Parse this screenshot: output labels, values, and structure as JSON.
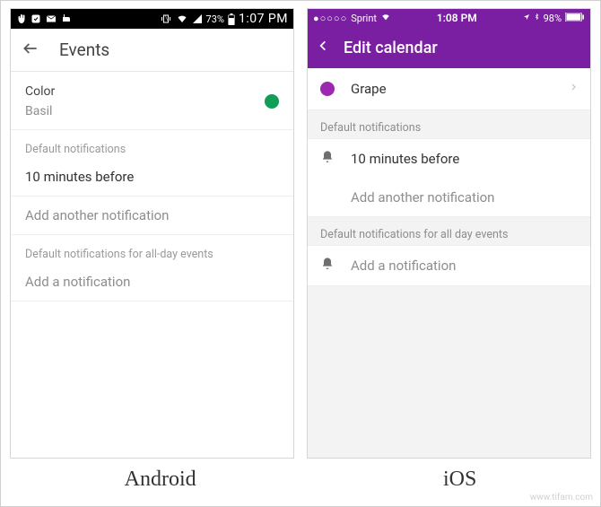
{
  "android": {
    "status": {
      "battery": "73%",
      "time": "1:07 PM"
    },
    "appbar": {
      "title": "Events"
    },
    "color": {
      "label": "Color",
      "name": "Basil",
      "swatch": "#0f9d58"
    },
    "defaults_title": "Default notifications",
    "notif1": "10 minutes before",
    "add_another": "Add another notification",
    "allday_title": "Default notifications for all-day events",
    "add_allday": "Add a notification"
  },
  "ios": {
    "status": {
      "carrier": "Sprint",
      "time": "1:08 PM",
      "battery": "98%"
    },
    "navbar": {
      "title": "Edit calendar"
    },
    "color_row": {
      "name": "Grape",
      "swatch": "#9c27b0"
    },
    "defaults_title": "Default notifications",
    "notif1": "10 minutes before",
    "add_another": "Add another notification",
    "allday_title": "Default notifications for all day events",
    "add_allday": "Add a notification"
  },
  "captions": {
    "android": "Android",
    "ios": "iOS"
  },
  "watermark": "www.tifam.com"
}
